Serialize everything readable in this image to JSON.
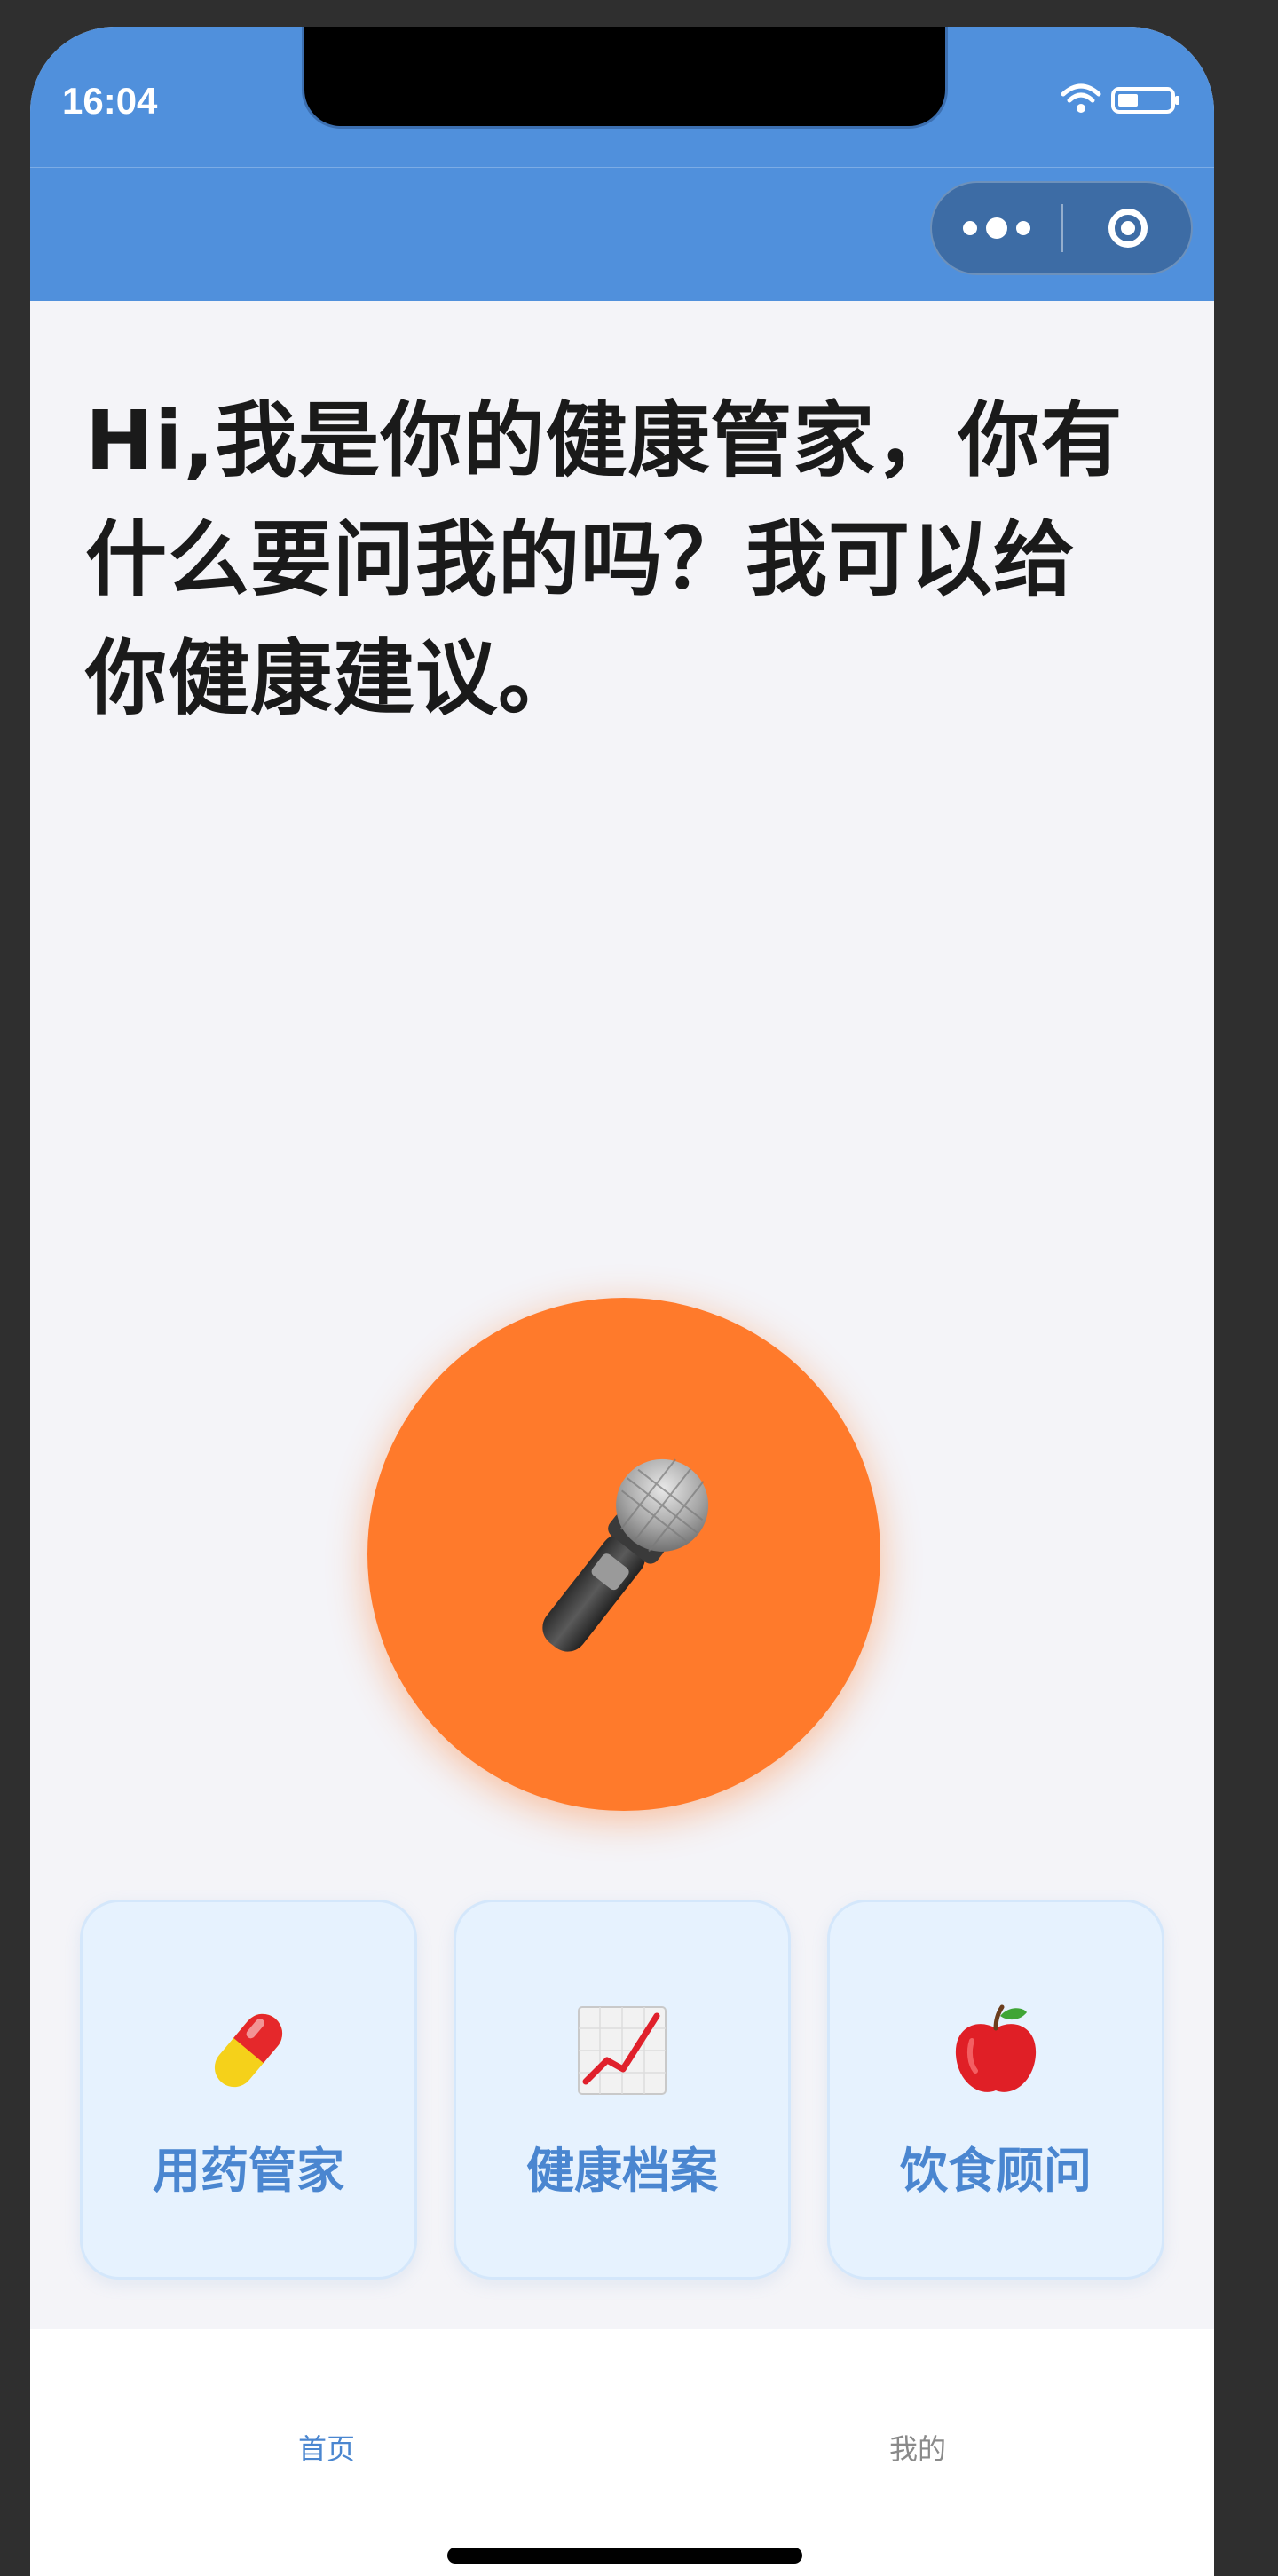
{
  "status_bar": {
    "time": "16:04",
    "wifi_icon": "wifi-icon",
    "battery_icon": "battery-icon"
  },
  "nav": {
    "more_icon": "more-dots-icon",
    "close_icon": "target-close-icon",
    "background_color": "#5090dc"
  },
  "main": {
    "greeting": "Hi,我是你的健康管家，你有什么要问我的吗？我可以给你健康建议。",
    "mic_button": {
      "icon": "microphone-icon",
      "color": "#ff7a2b"
    },
    "cards": [
      {
        "icon": "pill-icon",
        "label": "用药管家"
      },
      {
        "icon": "chart-increasing-icon",
        "label": "健康档案"
      },
      {
        "icon": "apple-icon",
        "label": "饮食顾问"
      }
    ]
  },
  "tab_bar": {
    "tabs": [
      {
        "label": "首页",
        "active": true
      },
      {
        "label": "我的",
        "active": false
      }
    ],
    "active_color": "#4a86d0",
    "inactive_color": "#8a8a8a"
  }
}
